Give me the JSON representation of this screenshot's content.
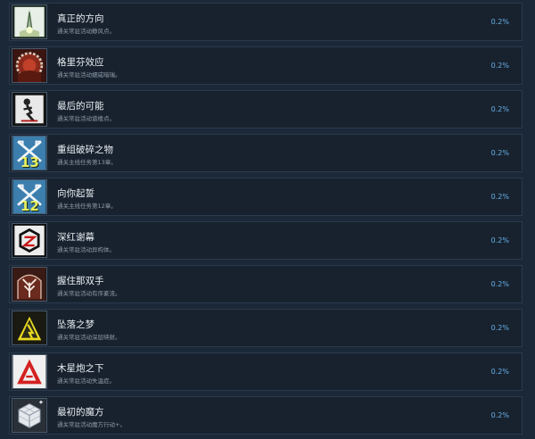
{
  "achievements": [
    {
      "title": "真正的方向",
      "description": "通关常驻活动静风点。",
      "percent": "0.2%",
      "icon": "light-spire-icon"
    },
    {
      "title": "格里芬效应",
      "description": "通关常驻活动蠕咸暗瑞。",
      "percent": "0.2%",
      "icon": "red-gear-icon"
    },
    {
      "title": "最后的可能",
      "description": "通关常驻活动谱楼点。",
      "percent": "0.2%",
      "icon": "broken-doll-icon"
    },
    {
      "title": "重组破碎之物",
      "description": "通关主线任务第13章。",
      "percent": "0.2%",
      "icon": "crossed-rifles-13-icon",
      "badge": "13"
    },
    {
      "title": "向你起誓",
      "description": "通关主线任务第12章。",
      "percent": "0.2%",
      "icon": "crossed-rifles-12-icon",
      "badge": "12"
    },
    {
      "title": "深红谢幕",
      "description": "通关常驻活动异构体。",
      "percent": "0.2%",
      "icon": "hexagon-logo-icon"
    },
    {
      "title": "握住那双手",
      "description": "通关常驻活动有序紊流。",
      "percent": "0.2%",
      "icon": "arch-tree-icon"
    },
    {
      "title": "坠落之梦",
      "description": "通关常驻活动深层映射。",
      "percent": "0.2%",
      "icon": "yellow-warning-icon"
    },
    {
      "title": "木星炮之下",
      "description": "通关常驻活动失温症。",
      "percent": "0.2%",
      "icon": "red-triangle-icon"
    },
    {
      "title": "最初的魔方",
      "description": "通关常驻活动魔方行动+。",
      "percent": "0.2%",
      "icon": "cube-icon"
    }
  ]
}
